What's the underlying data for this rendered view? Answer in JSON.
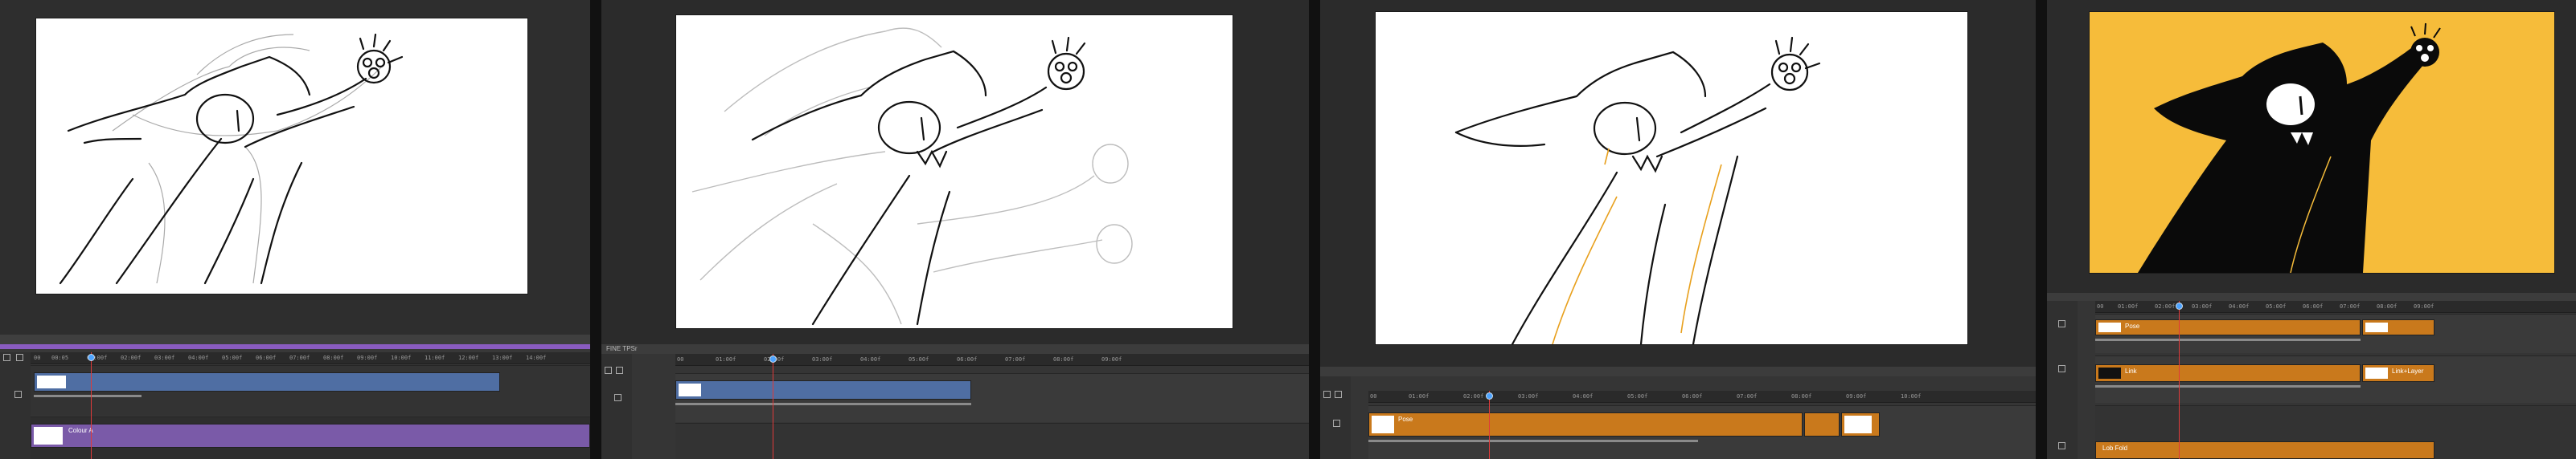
{
  "colors": {
    "bg": "#2e2e2e",
    "clip_blue": "#4f6ea3",
    "clip_purple": "#7a5aa8",
    "clip_orange": "#c9791c",
    "playhead": "#e03a3a",
    "cat_fill_yellow": "#f6bc3a"
  },
  "icons": [
    "scissors-icon",
    "link-icon",
    "play-icon",
    "pause-icon",
    "add-icon"
  ],
  "panel1": {
    "ruler_ticks": [
      "00",
      "00:05",
      "01:00f",
      "02:00f",
      "03:00f",
      "04:00f",
      "05:00f",
      "06:00f",
      "07:00f",
      "08:00f",
      "09:00f",
      "10:00f",
      "11:00f",
      "12:00f",
      "13:00f",
      "14:00f"
    ],
    "track2_label": "Colour A"
  },
  "panel2": {
    "title": "FINE TPSr",
    "ruler_ticks": [
      "00",
      "01:00f",
      "02:00f",
      "03:00f",
      "04:00f",
      "05:00f",
      "06:00f",
      "07:00f",
      "08:00f",
      "09:00f"
    ]
  },
  "panel3": {
    "ruler_ticks": [
      "00",
      "01:00f",
      "02:00f",
      "03:00f",
      "04:00f",
      "05:00f",
      "06:00f",
      "07:00f",
      "08:00f",
      "09:00f",
      "10:00f"
    ],
    "clip_label": "Pose"
  },
  "panel4": {
    "ruler_ticks": [
      "00",
      "01:00f",
      "02:00f",
      "03:00f",
      "04:00f",
      "05:00f",
      "06:00f",
      "07:00f",
      "08:00f",
      "09:00f"
    ],
    "clips": [
      "Pose",
      "Link",
      "Link+Layer",
      "Lob Fold"
    ]
  }
}
